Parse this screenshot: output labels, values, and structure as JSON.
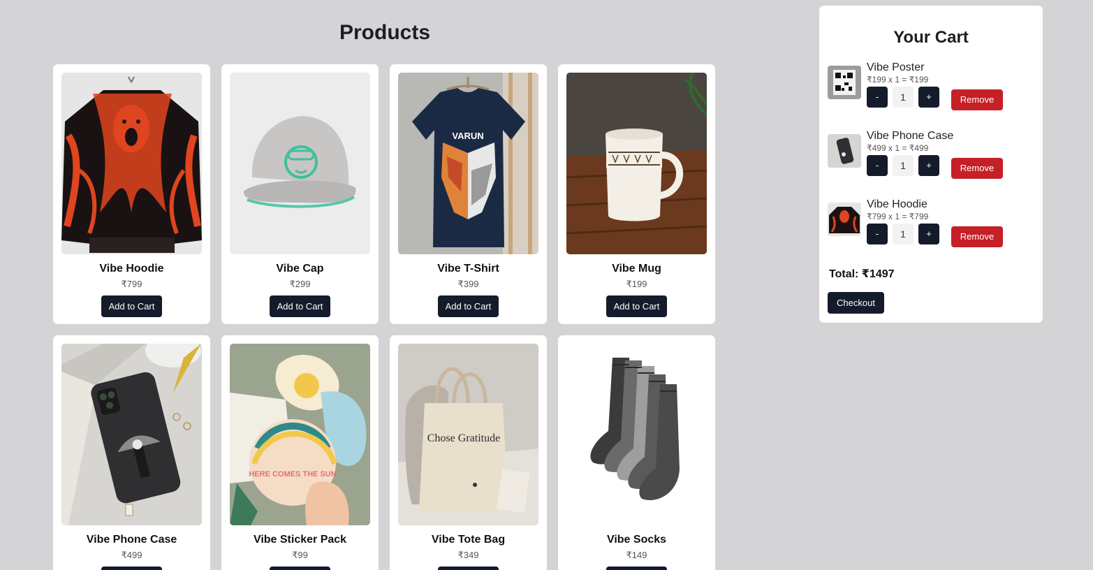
{
  "products_section": {
    "title": "Products",
    "add_label": "Add to Cart",
    "items": [
      {
        "name": "Vibe Hoodie",
        "price": "₹799"
      },
      {
        "name": "Vibe Cap",
        "price": "₹299"
      },
      {
        "name": "Vibe T-Shirt",
        "price": "₹399"
      },
      {
        "name": "Vibe Mug",
        "price": "₹199"
      },
      {
        "name": "Vibe Phone Case",
        "price": "₹499"
      },
      {
        "name": "Vibe Sticker Pack",
        "price": "₹99"
      },
      {
        "name": "Vibe Tote Bag",
        "price": "₹349"
      },
      {
        "name": "Vibe Socks",
        "price": "₹149"
      }
    ],
    "tshirt_print_text": "VARUN",
    "tote_print_text": "Chose Gratitude",
    "sticker_text": "HERE COMES THE SUN"
  },
  "cart": {
    "title": "Your Cart",
    "decrement_label": "-",
    "increment_label": "+",
    "remove_label": "Remove",
    "items": [
      {
        "name": "Vibe Poster",
        "line": "₹199 x 1 = ₹199",
        "qty": "1"
      },
      {
        "name": "Vibe Phone Case",
        "line": "₹499 x 1 = ₹499",
        "qty": "1"
      },
      {
        "name": "Vibe Hoodie",
        "line": "₹799 x 1 = ₹799",
        "qty": "1"
      }
    ],
    "total": "Total: ₹1497",
    "checkout_label": "Checkout"
  },
  "colors": {
    "page_bg": "#d4d4d6",
    "button_dark": "#141b2b",
    "remove_red": "#c52026"
  }
}
